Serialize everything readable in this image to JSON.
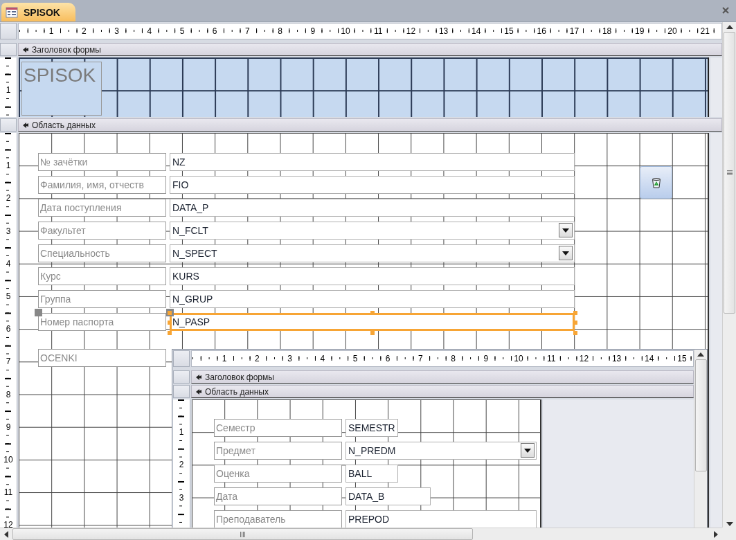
{
  "tab": {
    "title": "SPISOK",
    "selected": true
  },
  "ruler": [
    "1",
    "2",
    "3",
    "4",
    "5",
    "6",
    "7",
    "8",
    "9",
    "10",
    "11",
    "12",
    "13",
    "14",
    "15",
    "16",
    "17",
    "18",
    "19",
    "20",
    "21"
  ],
  "header_section": {
    "title": "Заголовок формы",
    "ruler": [
      "1"
    ],
    "form_title": "SPISOK"
  },
  "detail_section": {
    "title": "Область данных",
    "ruler": [
      "1",
      "2",
      "3",
      "4",
      "5",
      "6",
      "7",
      "8",
      "9",
      "10",
      "11",
      "12"
    ],
    "rows": [
      {
        "label": "№ зачётки",
        "field": "NZ",
        "kind": "textbox",
        "selected": false
      },
      {
        "label": "Фамилия, имя, отчеств",
        "field": "FIO",
        "kind": "textbox",
        "selected": false
      },
      {
        "label": "Дата поступления",
        "field": "DATA_P",
        "kind": "textbox",
        "selected": false
      },
      {
        "label": "Факультет",
        "field": "N_FCLT",
        "kind": "combo",
        "selected": false
      },
      {
        "label": "Специальность",
        "field": "N_SPECT",
        "kind": "combo",
        "selected": false
      },
      {
        "label": "Курс",
        "field": "KURS",
        "kind": "textbox",
        "selected": false
      },
      {
        "label": "Группа",
        "field": "N_GRUP",
        "kind": "textbox",
        "selected": false
      },
      {
        "label": "Номер паспорта",
        "field": "N_PASP",
        "kind": "textbox",
        "selected": true
      }
    ],
    "subform_label": "OCENKI",
    "subform": {
      "ruler": [
        "1",
        "2",
        "3",
        "4",
        "5",
        "6",
        "7",
        "8",
        "9",
        "10",
        "11",
        "12",
        "13",
        "14",
        "15"
      ],
      "header_title": "Заголовок формы",
      "detail_title": "Область данных",
      "detail_ruler": [
        "1",
        "2",
        "3"
      ],
      "rows": [
        {
          "label": "Семестр",
          "field": "SEMESTR",
          "kind": "textbox",
          "selected": false
        },
        {
          "label": "Предмет",
          "field": "N_PREDM",
          "kind": "combo",
          "selected": false
        },
        {
          "label": "Оценка",
          "field": "BALL",
          "kind": "textbox",
          "selected": false
        },
        {
          "label": "Дата",
          "field": "DATA_B",
          "kind": "textbox",
          "selected": false
        },
        {
          "label": "Преподаватель",
          "field": "PREPOD",
          "kind": "textbox",
          "selected": false
        }
      ]
    }
  }
}
